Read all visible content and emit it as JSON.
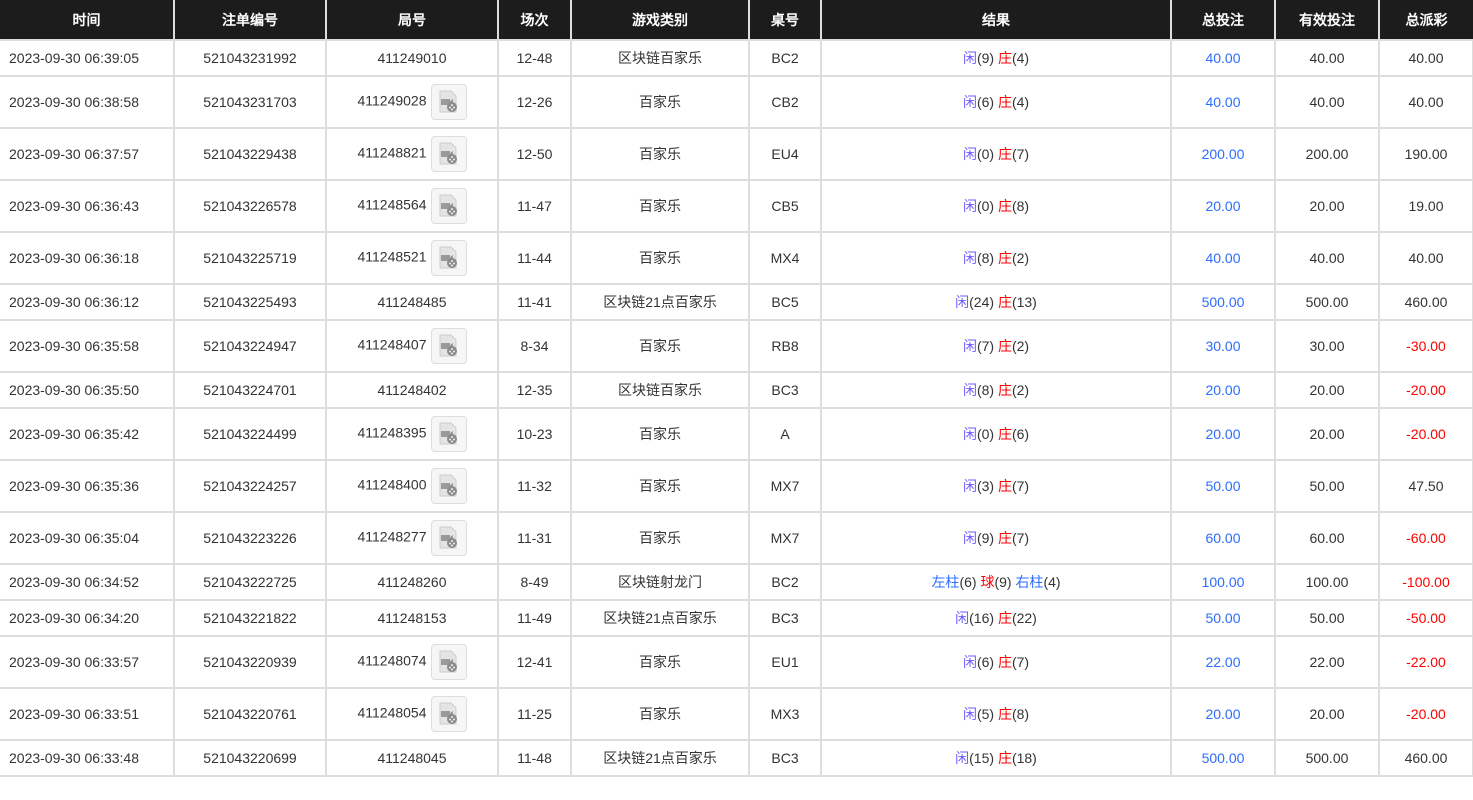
{
  "headers": [
    "时间",
    "注单编号",
    "局号",
    "场次",
    "游戏类别",
    "桌号",
    "结果",
    "总投注",
    "有效投注",
    "总派彩"
  ],
  "colors": {
    "player": "#6a5cff",
    "banker": "#ff0000",
    "bet": "#2c6cff",
    "negative": "#ff0000"
  },
  "rows": [
    {
      "time": "2023-09-30 06:39:05",
      "order": "521043231992",
      "round": "411249010",
      "video": false,
      "shoe": "12-48",
      "game": "区块链百家乐",
      "table": "BC2",
      "result": [
        {
          "t": "闲",
          "c": "xian"
        },
        {
          "t": "(9) "
        },
        {
          "t": "庄",
          "c": "zhuang"
        },
        {
          "t": "(4)"
        }
      ],
      "bet": "40.00",
      "valid": "40.00",
      "payout": "40.00",
      "neg": false
    },
    {
      "time": "2023-09-30 06:38:58",
      "order": "521043231703",
      "round": "411249028",
      "video": true,
      "shoe": "12-26",
      "game": "百家乐",
      "table": "CB2",
      "result": [
        {
          "t": "闲",
          "c": "xian"
        },
        {
          "t": "(6) "
        },
        {
          "t": "庄",
          "c": "zhuang"
        },
        {
          "t": "(4)"
        }
      ],
      "bet": "40.00",
      "valid": "40.00",
      "payout": "40.00",
      "neg": false
    },
    {
      "time": "2023-09-30 06:37:57",
      "order": "521043229438",
      "round": "411248821",
      "video": true,
      "shoe": "12-50",
      "game": "百家乐",
      "table": "EU4",
      "result": [
        {
          "t": "闲",
          "c": "xian"
        },
        {
          "t": "(0) "
        },
        {
          "t": "庄",
          "c": "zhuang"
        },
        {
          "t": "(7)"
        }
      ],
      "bet": "200.00",
      "valid": "200.00",
      "payout": "190.00",
      "neg": false
    },
    {
      "time": "2023-09-30 06:36:43",
      "order": "521043226578",
      "round": "411248564",
      "video": true,
      "shoe": "11-47",
      "game": "百家乐",
      "table": "CB5",
      "result": [
        {
          "t": "闲",
          "c": "xian"
        },
        {
          "t": "(0) "
        },
        {
          "t": "庄",
          "c": "zhuang"
        },
        {
          "t": "(8)"
        }
      ],
      "bet": "20.00",
      "valid": "20.00",
      "payout": "19.00",
      "neg": false
    },
    {
      "time": "2023-09-30 06:36:18",
      "order": "521043225719",
      "round": "411248521",
      "video": true,
      "shoe": "11-44",
      "game": "百家乐",
      "table": "MX4",
      "result": [
        {
          "t": "闲",
          "c": "xian"
        },
        {
          "t": "(8) "
        },
        {
          "t": "庄",
          "c": "zhuang"
        },
        {
          "t": "(2)"
        }
      ],
      "bet": "40.00",
      "valid": "40.00",
      "payout": "40.00",
      "neg": false
    },
    {
      "time": "2023-09-30 06:36:12",
      "order": "521043225493",
      "round": "411248485",
      "video": false,
      "shoe": "11-41",
      "game": "区块链21点百家乐",
      "table": "BC5",
      "result": [
        {
          "t": "闲",
          "c": "xian"
        },
        {
          "t": "(24) "
        },
        {
          "t": "庄",
          "c": "zhuang"
        },
        {
          "t": "(13)"
        }
      ],
      "bet": "500.00",
      "valid": "500.00",
      "payout": "460.00",
      "neg": false
    },
    {
      "time": "2023-09-30 06:35:58",
      "order": "521043224947",
      "round": "411248407",
      "video": true,
      "shoe": "8-34",
      "game": "百家乐",
      "table": "RB8",
      "result": [
        {
          "t": "闲",
          "c": "xian"
        },
        {
          "t": "(7) "
        },
        {
          "t": "庄",
          "c": "zhuang"
        },
        {
          "t": "(2)"
        }
      ],
      "bet": "30.00",
      "valid": "30.00",
      "payout": "-30.00",
      "neg": true
    },
    {
      "time": "2023-09-30 06:35:50",
      "order": "521043224701",
      "round": "411248402",
      "video": false,
      "shoe": "12-35",
      "game": "区块链百家乐",
      "table": "BC3",
      "result": [
        {
          "t": "闲",
          "c": "xian"
        },
        {
          "t": "(8) "
        },
        {
          "t": "庄",
          "c": "zhuang"
        },
        {
          "t": "(2)"
        }
      ],
      "bet": "20.00",
      "valid": "20.00",
      "payout": "-20.00",
      "neg": true
    },
    {
      "time": "2023-09-30 06:35:42",
      "order": "521043224499",
      "round": "411248395",
      "video": true,
      "shoe": "10-23",
      "game": "百家乐",
      "table": "A",
      "result": [
        {
          "t": "闲",
          "c": "xian"
        },
        {
          "t": "(0) "
        },
        {
          "t": "庄",
          "c": "zhuang"
        },
        {
          "t": "(6)"
        }
      ],
      "bet": "20.00",
      "valid": "20.00",
      "payout": "-20.00",
      "neg": true
    },
    {
      "time": "2023-09-30 06:35:36",
      "order": "521043224257",
      "round": "411248400",
      "video": true,
      "shoe": "11-32",
      "game": "百家乐",
      "table": "MX7",
      "result": [
        {
          "t": "闲",
          "c": "xian"
        },
        {
          "t": "(3) "
        },
        {
          "t": "庄",
          "c": "zhuang"
        },
        {
          "t": "(7)"
        }
      ],
      "bet": "50.00",
      "valid": "50.00",
      "payout": "47.50",
      "neg": false
    },
    {
      "time": "2023-09-30 06:35:04",
      "order": "521043223226",
      "round": "411248277",
      "video": true,
      "shoe": "11-31",
      "game": "百家乐",
      "table": "MX7",
      "result": [
        {
          "t": "闲",
          "c": "xian"
        },
        {
          "t": "(9) "
        },
        {
          "t": "庄",
          "c": "zhuang"
        },
        {
          "t": "(7)"
        }
      ],
      "bet": "60.00",
      "valid": "60.00",
      "payout": "-60.00",
      "neg": true
    },
    {
      "time": "2023-09-30 06:34:52",
      "order": "521043222725",
      "round": "411248260",
      "video": false,
      "shoe": "8-49",
      "game": "区块链射龙门",
      "table": "BC2",
      "result": [
        {
          "t": "左柱",
          "c": "blue"
        },
        {
          "t": "(6) "
        },
        {
          "t": "球",
          "c": "zhuang"
        },
        {
          "t": "(9) "
        },
        {
          "t": "右柱",
          "c": "blue"
        },
        {
          "t": "(4)"
        }
      ],
      "bet": "100.00",
      "valid": "100.00",
      "payout": "-100.00",
      "neg": true
    },
    {
      "time": "2023-09-30 06:34:20",
      "order": "521043221822",
      "round": "411248153",
      "video": false,
      "shoe": "11-49",
      "game": "区块链21点百家乐",
      "table": "BC3",
      "result": [
        {
          "t": "闲",
          "c": "xian"
        },
        {
          "t": "(16) "
        },
        {
          "t": "庄",
          "c": "zhuang"
        },
        {
          "t": "(22)"
        }
      ],
      "bet": "50.00",
      "valid": "50.00",
      "payout": "-50.00",
      "neg": true
    },
    {
      "time": "2023-09-30 06:33:57",
      "order": "521043220939",
      "round": "411248074",
      "video": true,
      "shoe": "12-41",
      "game": "百家乐",
      "table": "EU1",
      "result": [
        {
          "t": "闲",
          "c": "xian"
        },
        {
          "t": "(6) "
        },
        {
          "t": "庄",
          "c": "zhuang"
        },
        {
          "t": "(7)"
        }
      ],
      "bet": "22.00",
      "valid": "22.00",
      "payout": "-22.00",
      "neg": true
    },
    {
      "time": "2023-09-30 06:33:51",
      "order": "521043220761",
      "round": "411248054",
      "video": true,
      "shoe": "11-25",
      "game": "百家乐",
      "table": "MX3",
      "result": [
        {
          "t": "闲",
          "c": "xian"
        },
        {
          "t": "(5) "
        },
        {
          "t": "庄",
          "c": "zhuang"
        },
        {
          "t": "(8)"
        }
      ],
      "bet": "20.00",
      "valid": "20.00",
      "payout": "-20.00",
      "neg": true
    },
    {
      "time": "2023-09-30 06:33:48",
      "order": "521043220699",
      "round": "411248045",
      "video": false,
      "shoe": "11-48",
      "game": "区块链21点百家乐",
      "table": "BC3",
      "result": [
        {
          "t": "闲",
          "c": "xian"
        },
        {
          "t": "(15) "
        },
        {
          "t": "庄",
          "c": "zhuang"
        },
        {
          "t": "(18)"
        }
      ],
      "bet": "500.00",
      "valid": "500.00",
      "payout": "460.00",
      "neg": false
    }
  ]
}
